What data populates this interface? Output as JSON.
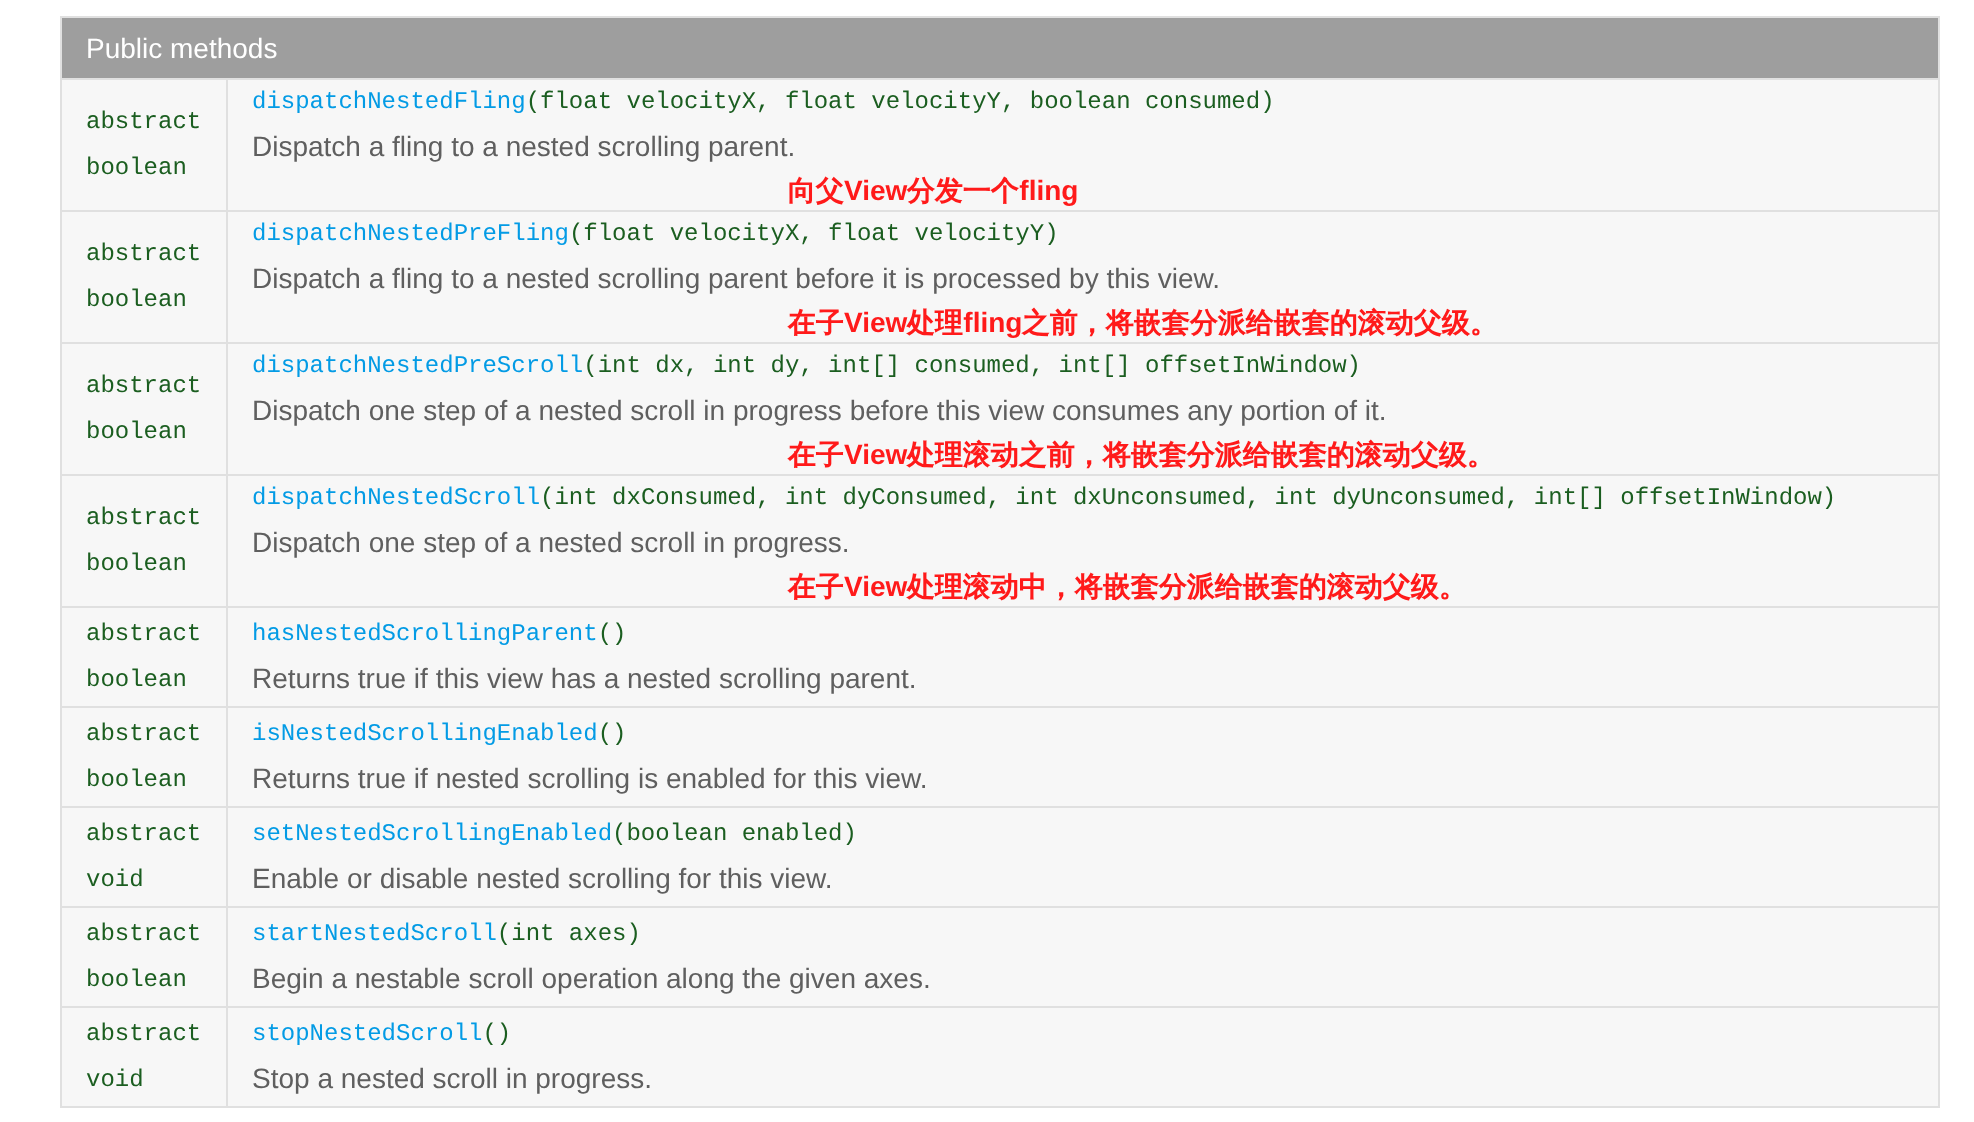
{
  "table": {
    "title": "Public methods",
    "rows": [
      {
        "modifier": "abstract",
        "type": "boolean",
        "method": "dispatchNestedFling",
        "params": "(float velocityX, float velocityY, boolean consumed)",
        "description": "Dispatch a fling to a nested scrolling parent.",
        "annotation": "向父View分发一个fling"
      },
      {
        "modifier": "abstract",
        "type": "boolean",
        "method": "dispatchNestedPreFling",
        "params": "(float velocityX, float velocityY)",
        "description": "Dispatch a fling to a nested scrolling parent before it is processed by this view.",
        "annotation": "在子View处理fling之前，将嵌套分派给嵌套的滚动父级。"
      },
      {
        "modifier": "abstract",
        "type": "boolean",
        "method": "dispatchNestedPreScroll",
        "params": "(int dx, int dy, int[] consumed, int[] offsetInWindow)",
        "description": "Dispatch one step of a nested scroll in progress before this view consumes any portion of it.",
        "annotation": "在子View处理滚动之前，将嵌套分派给嵌套的滚动父级。"
      },
      {
        "modifier": "abstract",
        "type": "boolean",
        "method": "dispatchNestedScroll",
        "params": "(int dxConsumed, int dyConsumed, int dxUnconsumed, int dyUnconsumed, int[] offsetInWindow)",
        "description": "Dispatch one step of a nested scroll in progress.",
        "annotation": "在子View处理滚动中，将嵌套分派给嵌套的滚动父级。"
      },
      {
        "modifier": "abstract",
        "type": "boolean",
        "method": "hasNestedScrollingParent",
        "params": "()",
        "description": "Returns true if this view has a nested scrolling parent."
      },
      {
        "modifier": "abstract",
        "type": "boolean",
        "method": "isNestedScrollingEnabled",
        "params": "()",
        "description": "Returns true if nested scrolling is enabled for this view."
      },
      {
        "modifier": "abstract",
        "type": "void",
        "method": "setNestedScrollingEnabled",
        "params": "(boolean enabled)",
        "description": "Enable or disable nested scrolling for this view."
      },
      {
        "modifier": "abstract",
        "type": "boolean",
        "method": "startNestedScroll",
        "params": "(int axes)",
        "description": "Begin a nestable scroll operation along the given axes."
      },
      {
        "modifier": "abstract",
        "type": "void",
        "method": "stopNestedScroll",
        "params": "()",
        "description": "Stop a nested scroll in progress."
      }
    ]
  }
}
